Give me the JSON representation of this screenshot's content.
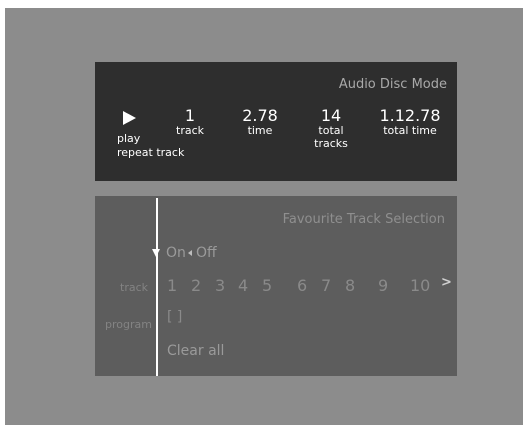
{
  "disc_panel": {
    "title": "Audio Disc Mode",
    "play_label": "play",
    "repeat_label": "repeat track",
    "track_value": "1",
    "track_label": "track",
    "time_value": "2.78",
    "time_label": "time",
    "total_tracks_value": "14",
    "total_tracks_label": "total tracks",
    "total_time_value": "1.12.78",
    "total_time_label": "total time"
  },
  "favourite_panel": {
    "title": "Favourite Track Selection",
    "on_label": "On",
    "off_label": "Off",
    "track_row_label": "track",
    "program_row_label": "program",
    "tracks": [
      "1",
      "2",
      "3",
      "4",
      "5",
      "6",
      "7",
      "8",
      "9",
      "10"
    ],
    "next_glyph": ">",
    "program_value": "[ ]",
    "clear_all_label": "Clear all"
  },
  "icons": [
    "play-icon",
    "cursor-down-icon",
    "arrow-left-icon",
    "next-page-icon"
  ],
  "colors": {
    "top_panel_bg": "#2e2e2e",
    "bottom_panel_bg": "#5d5d5d",
    "screen_bg": "#8c8c8c"
  }
}
